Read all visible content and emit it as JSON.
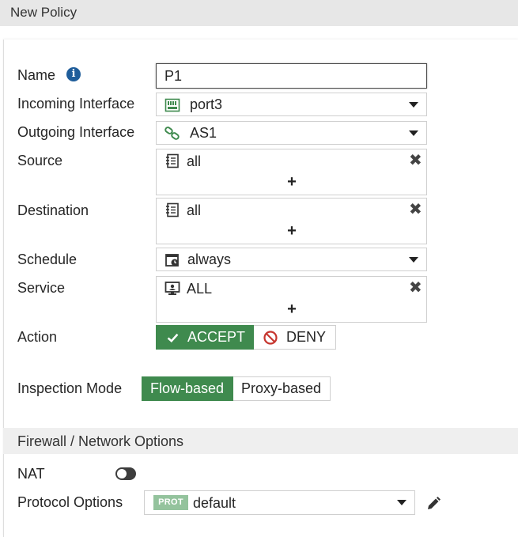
{
  "header": {
    "title": "New Policy"
  },
  "form": {
    "name": {
      "label": "Name",
      "value": "P1"
    },
    "incoming": {
      "label": "Incoming Interface",
      "value": "port3"
    },
    "outgoing": {
      "label": "Outgoing Interface",
      "value": "AS1"
    },
    "source": {
      "label": "Source",
      "value": "all",
      "add": "+",
      "remove": "✖"
    },
    "destination": {
      "label": "Destination",
      "value": "all",
      "add": "+",
      "remove": "✖"
    },
    "schedule": {
      "label": "Schedule",
      "value": "always"
    },
    "service": {
      "label": "Service",
      "value": "ALL",
      "add": "+",
      "remove": "✖"
    },
    "action": {
      "label": "Action",
      "accept": "ACCEPT",
      "deny": "DENY",
      "selected": "ACCEPT"
    },
    "inspection": {
      "label": "Inspection Mode",
      "flow": "Flow-based",
      "proxy": "Proxy-based",
      "selected": "Flow-based"
    }
  },
  "firewall_section": {
    "title": "Firewall / Network Options",
    "nat": {
      "label": "NAT",
      "enabled": false
    },
    "protocol_options": {
      "label": "Protocol Options",
      "badge": "PROT",
      "value": "default"
    }
  },
  "icons": {
    "info": "info-icon",
    "port": "port-icon",
    "link": "link-icon",
    "address": "address-book-icon",
    "schedule": "calendar-clock-icon",
    "service": "service-monitor-icon",
    "accept": "checkmark-icon",
    "deny": "deny-icon",
    "edit": "pencil-icon"
  },
  "colors": {
    "accent_green": "#3f8a4e",
    "badge_green": "#94c39d",
    "deny_red": "#c6362f",
    "info_blue": "#1f5d9a"
  }
}
